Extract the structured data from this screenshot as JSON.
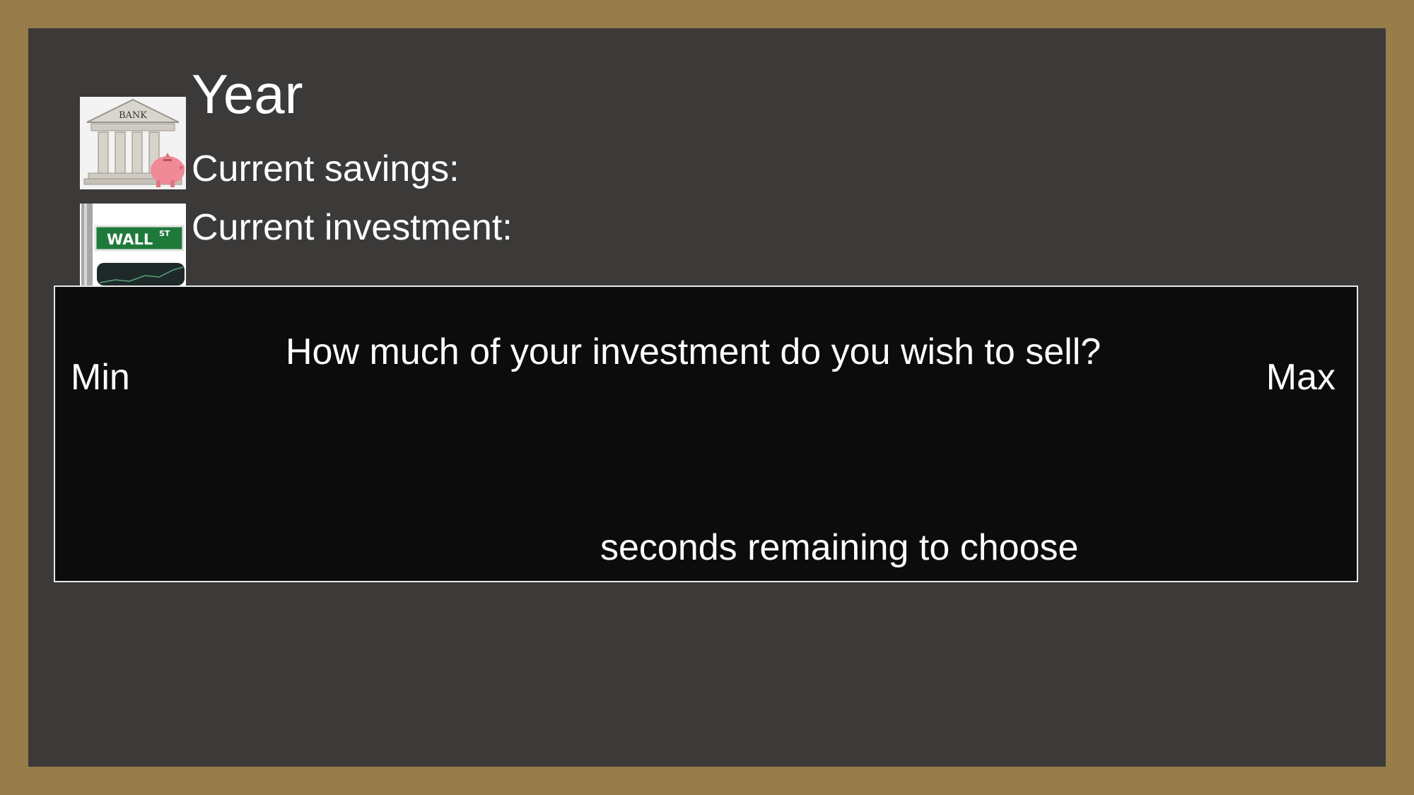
{
  "header": {
    "year_label": "Year",
    "savings_label": "Current savings:",
    "investment_label": "Current investment:"
  },
  "images": {
    "bank": {
      "sign_text": "BANK",
      "icon": "bank-building-icon"
    },
    "wall_street": {
      "sign_text": "WALL",
      "sign_superscript": "ST",
      "icon": "wall-street-sign-icon"
    }
  },
  "dialog": {
    "min_label": "Min",
    "max_label": "Max",
    "question": "How much of your investment do you wish to sell?",
    "timer_text": "seconds remaining to choose"
  },
  "colors": {
    "frame": "#967d4a",
    "background": "#3b3a39",
    "dialog_bg": "#0c0c0c",
    "text": "#ffffff",
    "sign_green": "#1f7a3a",
    "piggy_pink": "#f08a96"
  }
}
